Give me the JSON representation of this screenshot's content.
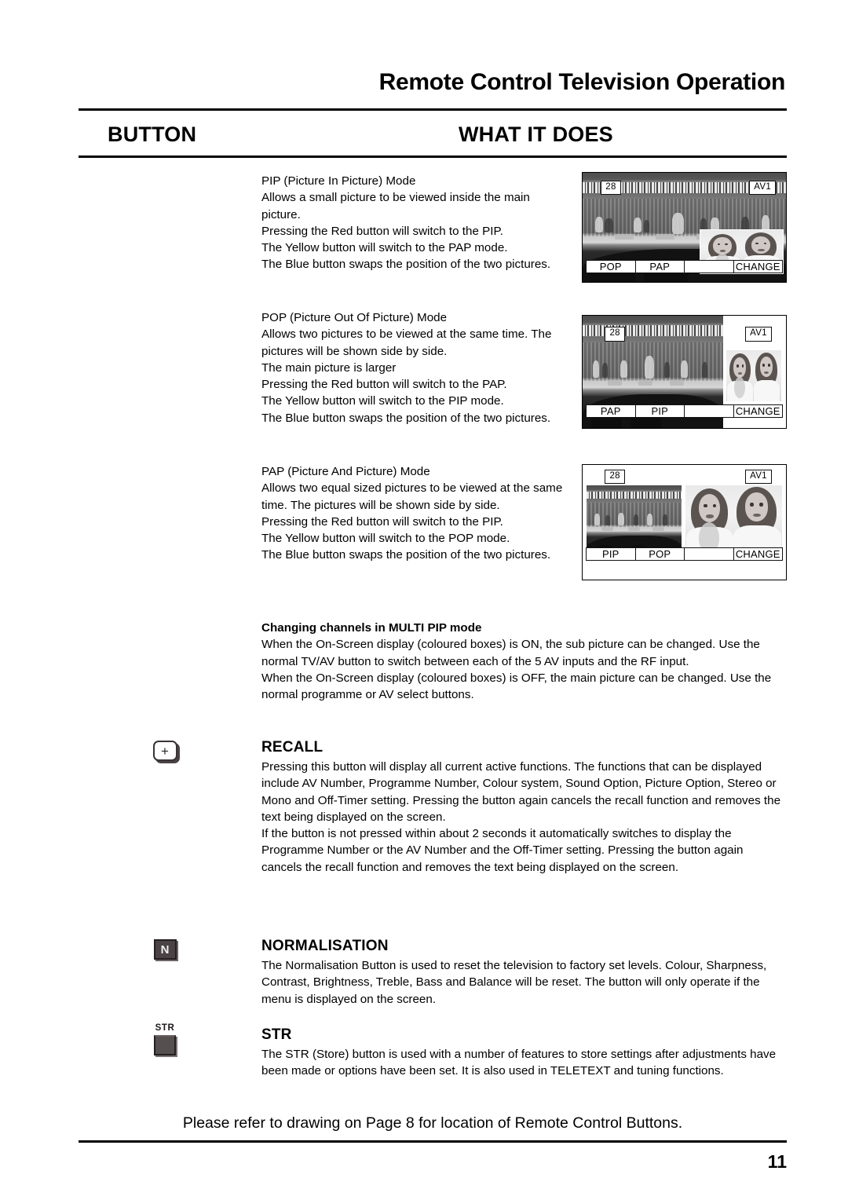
{
  "header": {
    "title": "Remote Control Television Operation",
    "col_button": "BUTTON",
    "col_what": "WHAT IT DOES"
  },
  "sections": {
    "pip": {
      "body": "PIP (Picture In Picture) Mode\nAllows a small picture to be viewed inside the main picture.\nPressing the Red button will switch to the PIP.\nThe Yellow button will switch to the PAP mode.\nThe Blue button swaps the position of the two pictures."
    },
    "pop": {
      "body": "POP (Picture Out Of Picture) Mode\nAllows two pictures to be viewed at the same time. The pictures will be shown side by side.\nThe main picture is larger\nPressing the Red button will switch to the PAP.\nThe Yellow button will switch to the PIP mode.\nThe Blue button swaps the position of the two pictures."
    },
    "pap": {
      "body": "PAP (Picture And Picture) Mode\nAllows two equal sized pictures to be viewed at the same time. The pictures will be shown side by side.\nPressing the Red button will switch to the PIP.\nThe Yellow button will switch to the POP mode.\nThe Blue button swaps the position of the two pictures."
    },
    "multi_pip": {
      "heading": "Changing channels in MULTI PIP mode",
      "body": "When the On-Screen display (coloured boxes) is ON, the sub picture can be changed. Use the normal TV/AV button to switch between each of the 5 AV inputs and the RF input.\nWhen the On-Screen display (coloured boxes) is OFF, the main picture can be changed. Use the normal programme or AV select buttons."
    },
    "recall": {
      "heading": "RECALL",
      "body": "Pressing this button will display all current active functions. The functions that can be displayed include AV Number, Programme Number, Colour system, Sound Option, Picture Option, Stereo or Mono and Off-Timer setting. Pressing the button again cancels the recall function and removes the text being displayed on the screen.\nIf the button is not pressed within about 2 seconds it automatically switches to display the Programme Number or the AV Number and the Off-Timer setting. Pressing the button again cancels the recall function and removes the text being displayed on the screen.",
      "button_glyph": "+"
    },
    "normalisation": {
      "heading": "NORMALISATION",
      "body": "The Normalisation Button is used to reset the television to factory set levels. Colour, Sharpness, Contrast, Brightness, Treble, Bass and Balance will be reset. The button will only operate if the menu is displayed on the screen.",
      "button_glyph": "N"
    },
    "str": {
      "heading": "STR",
      "body": "The STR (Store) button is used with a number of features to store settings after adjustments have been made or options have been set. It is also used in TELETEXT and tuning functions.",
      "button_label": "STR"
    }
  },
  "tv_screens": {
    "pip": {
      "programme": "28",
      "av": "AV1",
      "bar": [
        "POP",
        "PAP",
        "",
        "CHANGE"
      ]
    },
    "pop": {
      "programme": "28",
      "av": "AV1",
      "bar": [
        "PAP",
        "PIP",
        "",
        "CHANGE"
      ]
    },
    "pap": {
      "programme": "28",
      "av": "AV1",
      "bar": [
        "PIP",
        "POP",
        "",
        "CHANGE"
      ]
    }
  },
  "footer": {
    "note": "Please refer to drawing on Page 8 for location of Remote Control Buttons.",
    "page_number": "11"
  },
  "colors": {
    "ink": "#000000",
    "paper": "#ffffff",
    "key_dark": "#4a4245"
  }
}
